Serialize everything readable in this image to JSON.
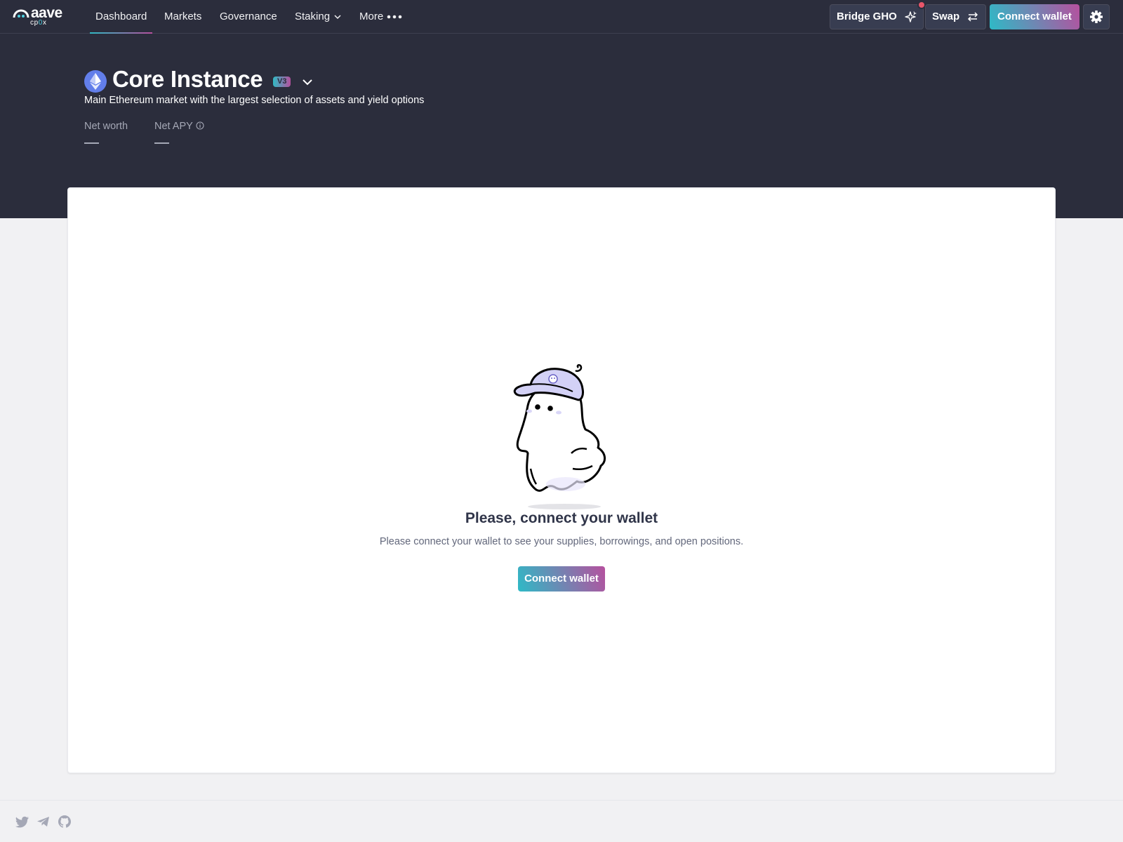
{
  "brand": {
    "name": "aave",
    "sub_prefix": "cp",
    "sub_zero": "0",
    "sub_suffix": "x"
  },
  "nav": {
    "items": [
      {
        "label": "Dashboard"
      },
      {
        "label": "Markets"
      },
      {
        "label": "Governance"
      },
      {
        "label": "Staking"
      },
      {
        "label": "More"
      }
    ]
  },
  "topbar": {
    "bridge_label": "Bridge GHO",
    "swap_label": "Swap",
    "connect_label": "Connect wallet"
  },
  "market": {
    "title": "Core Instance",
    "version": "V3",
    "description": "Main Ethereum market with the largest selection of assets and yield options",
    "net_worth_label": "Net worth",
    "net_apy_label": "Net APY"
  },
  "empty_state": {
    "title": "Please, connect your wallet",
    "text": "Please connect your wallet to see your supplies, borrowings, and open positions.",
    "button_label": "Connect wallet"
  },
  "colors": {
    "header": "#2b2d3c",
    "gradient_start": "#2ebac6",
    "gradient_end": "#b6509e",
    "notification_dot": "#e8566a",
    "ethereum": "#627eea"
  },
  "icons": [
    "twitter-icon",
    "telegram-icon",
    "github-icon",
    "settings-icon",
    "swap-arrows-icon",
    "sparkle-icon",
    "chevron-down-icon",
    "info-icon",
    "ethereum-icon",
    "dots-icon"
  ]
}
